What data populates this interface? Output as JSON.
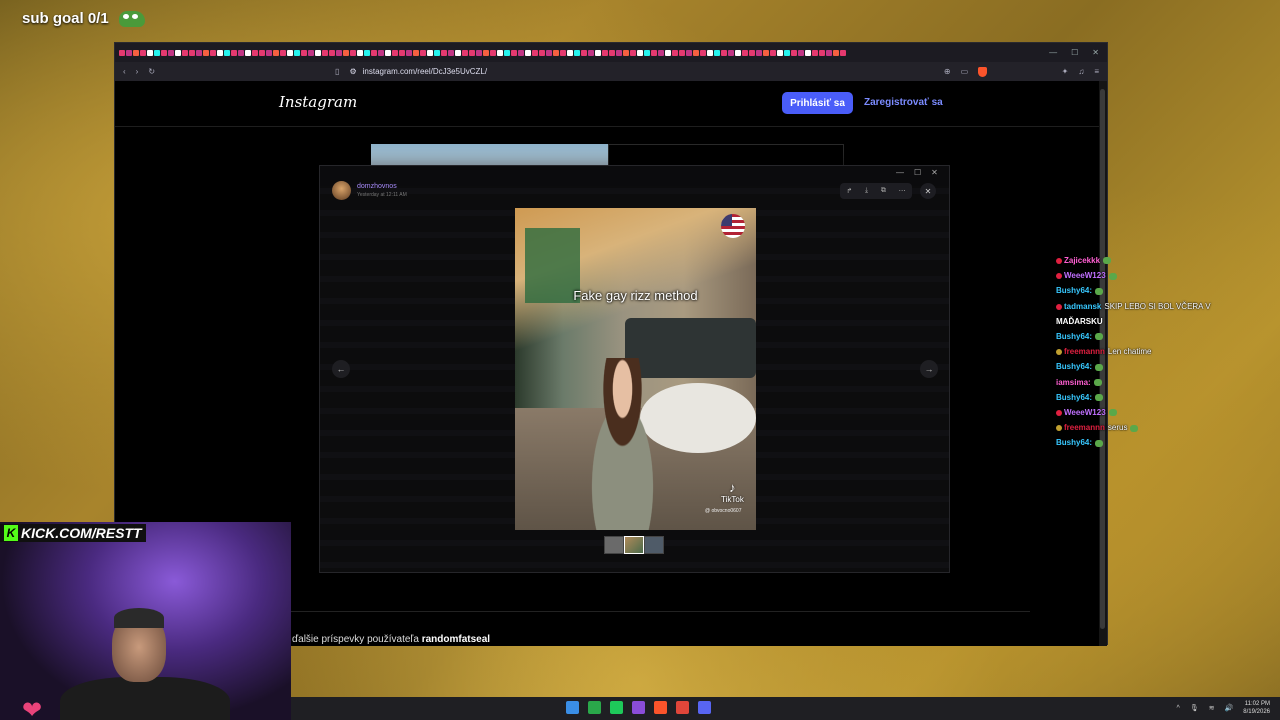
{
  "overlay": {
    "sub_goal": "sub goal 0/1"
  },
  "browser": {
    "url": "instagram.com/reel/DcJ3e5UvCZL/",
    "tab_count": 104,
    "tab_colors": [
      "#e5396f",
      "#c13584",
      "#f56040",
      "#e5396f",
      "#ffffff",
      "#25f4ee",
      "#e5396f",
      "#c13584",
      "#ffffff",
      "#e5396f"
    ]
  },
  "instagram": {
    "logo": "Instagram",
    "login_label": "Prihlásiť sa",
    "register_label": "Zaregistrovať sa",
    "more_posts_prefix": "ďalšie príspevky používateľa",
    "more_posts_user": "randomfatseal"
  },
  "popup": {
    "username": "domzhovnos",
    "timestamp": "Yesterday at 12:11 AM",
    "video_caption": "Fake gay rizz method",
    "tiktok_label": "TikTok",
    "tiktok_handle": "@ obvocno0607",
    "toolbar_icons": [
      "share-icon",
      "download-icon",
      "open-external-icon",
      "more-icon"
    ]
  },
  "webcam": {
    "kick_label": "KICK.COM/RESTT"
  },
  "chat": [
    {
      "user": "Zajicekkk",
      "color": "#ff5fd2",
      "badge": "#e02040",
      "msg": "",
      "emote": true
    },
    {
      "user": "WeeeW123",
      "color": "#c070ff",
      "badge": "#e02040",
      "msg": "",
      "emote": true
    },
    {
      "user": "Bushy64:",
      "color": "#38c8ff",
      "badge": "",
      "msg": "",
      "emote": true
    },
    {
      "user": "tadmansk",
      "color": "#38c8ff",
      "badge": "#e02040",
      "msg": "SKIP LEBO SI BOL VČERA V",
      "emote": false
    },
    {
      "user": "",
      "color": "#fff",
      "badge": "",
      "msg": "MAĎARSKU",
      "emote": false
    },
    {
      "user": "Bushy64:",
      "color": "#38c8ff",
      "badge": "",
      "msg": "",
      "emote": true
    },
    {
      "user": "freemannn",
      "color": "#e02040",
      "badge": "#c0a030",
      "msg": "Len chatime",
      "emote": false
    },
    {
      "user": "Bushy64:",
      "color": "#38c8ff",
      "badge": "",
      "msg": "",
      "emote": true
    },
    {
      "user": "iamsima:",
      "color": "#ff5fd2",
      "badge": "",
      "msg": "",
      "emote": true
    },
    {
      "user": "Bushy64:",
      "color": "#38c8ff",
      "badge": "",
      "msg": "",
      "emote": true
    },
    {
      "user": "WeeeW123",
      "color": "#c070ff",
      "badge": "#e02040",
      "msg": "",
      "emote": true
    },
    {
      "user": "freemannn",
      "color": "#e02040",
      "badge": "#c0a030",
      "msg": "serus",
      "emote": true
    },
    {
      "user": "Bushy64:",
      "color": "#38c8ff",
      "badge": "",
      "msg": "",
      "emote": true
    }
  ],
  "taskbar": {
    "time": "11:02 PM",
    "date": "8/19/2026",
    "app_colors": [
      "#3a8ee6",
      "#2aa84a",
      "#1ec95a",
      "#8a4dd8",
      "#fb542b",
      "#e0463a",
      "#5865f2"
    ]
  }
}
